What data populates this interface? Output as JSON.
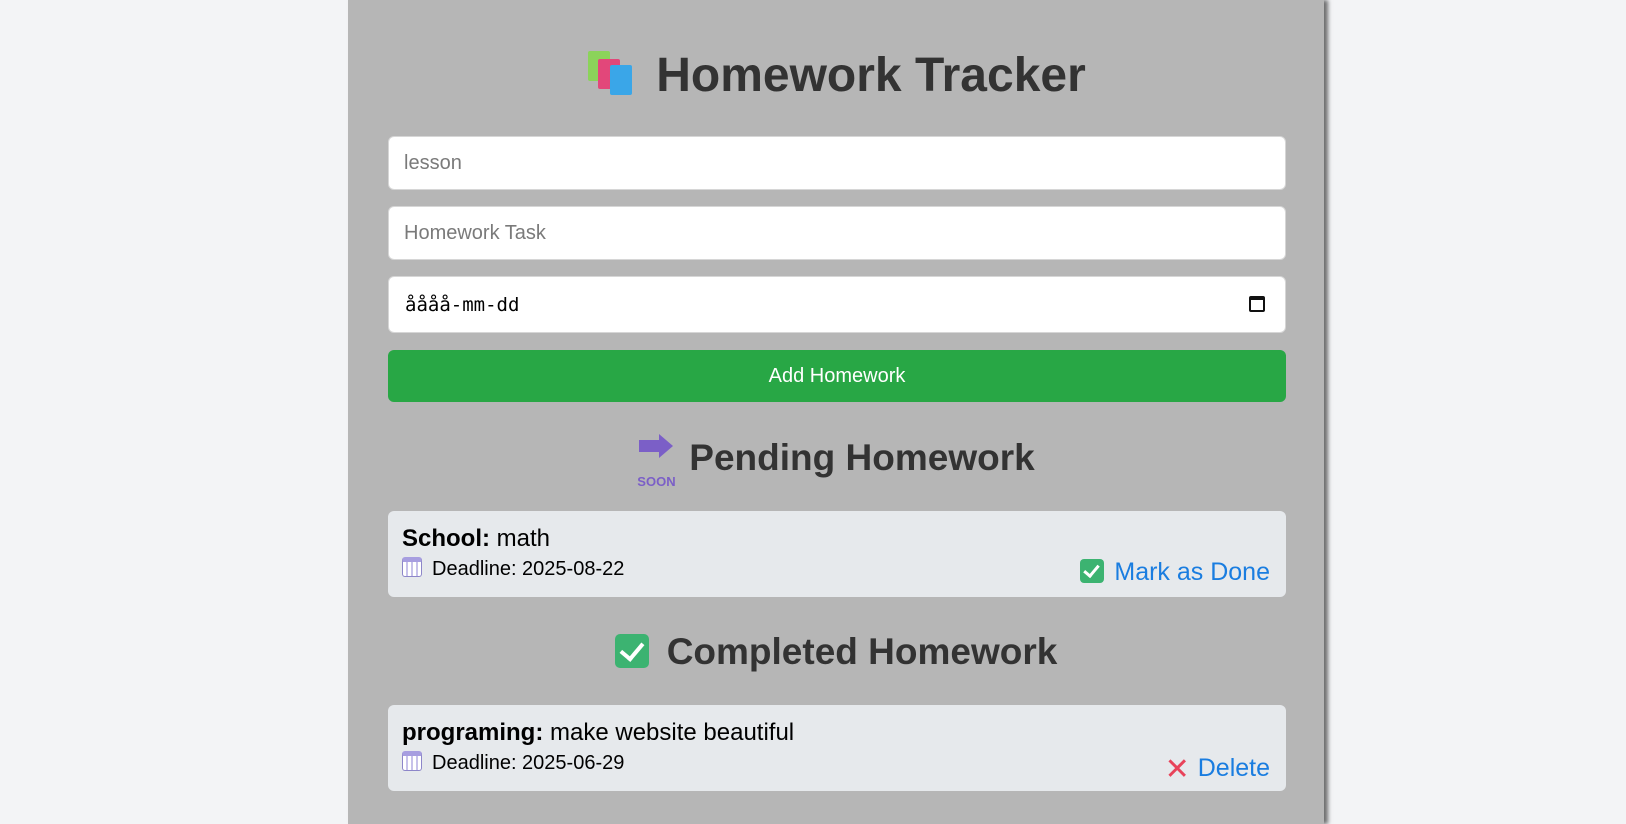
{
  "app": {
    "title": "Homework Tracker",
    "title_icon": "books-icon"
  },
  "form": {
    "lesson_placeholder": "lesson",
    "task_placeholder": "Homework Task",
    "date_placeholder": "åååå-mm-dd",
    "add_button_label": "Add Homework"
  },
  "pending": {
    "heading": "Pending Homework",
    "icon": "soon-arrow-icon",
    "icon_text": "SOON",
    "items": [
      {
        "subject": "School:",
        "task": "math",
        "deadline": "Deadline: 2025-08-22",
        "action_label": "Mark as Done"
      }
    ]
  },
  "completed": {
    "heading": "Completed Homework",
    "icon": "check-mark-button-icon",
    "items": [
      {
        "subject": "programing:",
        "task": "make website beautiful",
        "deadline": "Deadline: 2025-06-29",
        "action_label": "Delete"
      }
    ]
  },
  "colors": {
    "panel_bg": "#b6b6b6",
    "page_bg": "#f3f4f6",
    "add_button": "#28a745",
    "link": "#1a7de0",
    "card_bg": "#e6e9ec"
  }
}
